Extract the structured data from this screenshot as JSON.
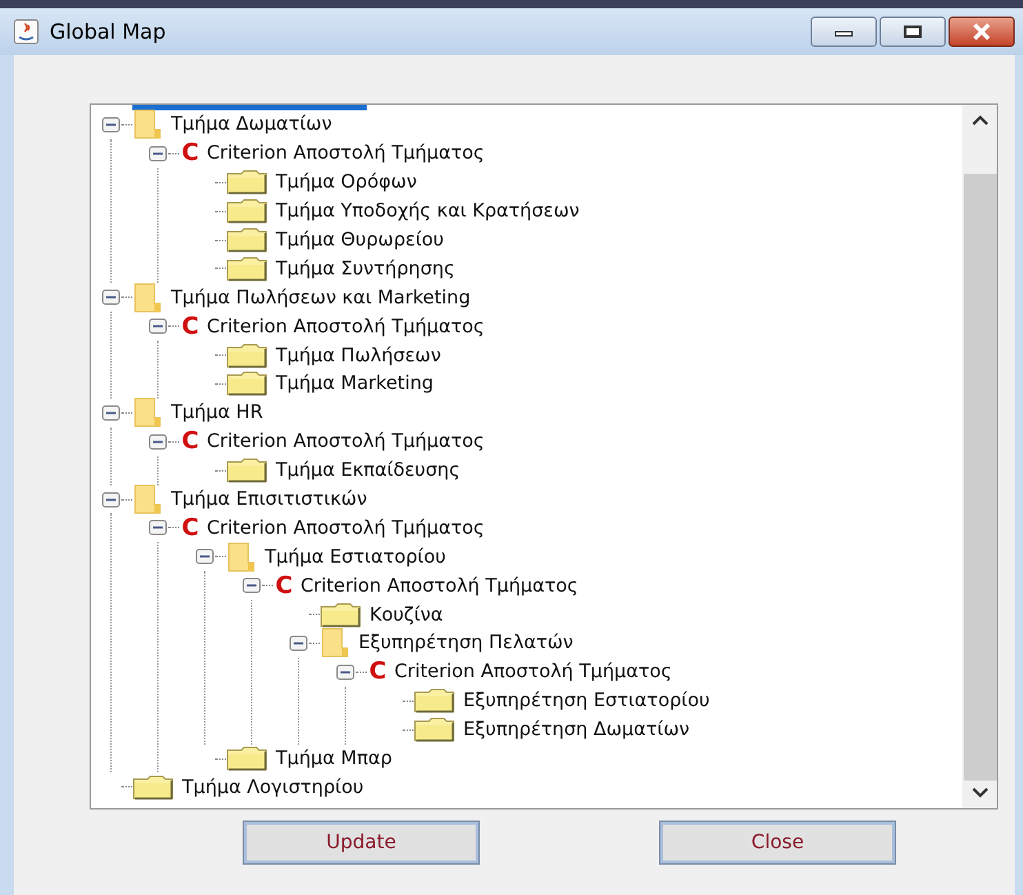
{
  "window": {
    "title": "Global Map"
  },
  "tree": {
    "nodes": [
      {
        "kind": "folder",
        "label": "Τμήμα Δωματίων",
        "expanded": true,
        "children": [
          {
            "kind": "criterion",
            "mark": "C",
            "label": "Criterion Αποστολή Τμήματος",
            "expanded": true,
            "children": [
              {
                "kind": "folder",
                "label": "Τμήμα Ορόφων"
              },
              {
                "kind": "folder",
                "label": "Τμήμα Υποδοχής και Κρατήσεων"
              },
              {
                "kind": "folder",
                "label": "Τμήμα Θυρωρείου"
              },
              {
                "kind": "folder",
                "label": "Τμήμα Συντήρησης"
              }
            ]
          }
        ]
      },
      {
        "kind": "folder",
        "label": "Τμήμα Πωλήσεων και Marketing",
        "expanded": true,
        "children": [
          {
            "kind": "criterion",
            "mark": "C",
            "label": "Criterion Αποστολή Τμήματος",
            "expanded": true,
            "children": [
              {
                "kind": "folder",
                "label": "Τμήμα Πωλήσεων"
              },
              {
                "kind": "folder",
                "label": "Τμήμα Marketing"
              }
            ]
          }
        ]
      },
      {
        "kind": "folder",
        "label": "Τμήμα HR",
        "expanded": true,
        "children": [
          {
            "kind": "criterion",
            "mark": "C",
            "label": "Criterion Αποστολή Τμήματος",
            "expanded": true,
            "children": [
              {
                "kind": "folder",
                "label": "Τμήμα Εκπαίδευσης"
              }
            ]
          }
        ]
      },
      {
        "kind": "folder",
        "label": "Τμήμα Επισιτιστικών",
        "expanded": true,
        "children": [
          {
            "kind": "criterion",
            "mark": "C",
            "label": "Criterion Αποστολή Τμήματος",
            "expanded": true,
            "children": [
              {
                "kind": "folder",
                "label": "Τμήμα Εστιατορίου",
                "expanded": true,
                "children": [
                  {
                    "kind": "criterion",
                    "mark": "C",
                    "label": "Criterion Αποστολή Τμήματος",
                    "expanded": true,
                    "children": [
                      {
                        "kind": "folder",
                        "label": "Κουζίνα"
                      },
                      {
                        "kind": "folder",
                        "label": "Εξυπηρέτηση Πελατών",
                        "expanded": true,
                        "children": [
                          {
                            "kind": "criterion",
                            "mark": "C",
                            "label": "Criterion Αποστολή Τμήματος",
                            "expanded": true,
                            "children": [
                              {
                                "kind": "folder",
                                "label": "Εξυπηρέτηση Εστιατορίου"
                              },
                              {
                                "kind": "folder",
                                "label": "Εξυπηρέτηση Δωματίων"
                              }
                            ]
                          }
                        ]
                      }
                    ]
                  }
                ]
              },
              {
                "kind": "folder",
                "label": "Τμήμα Μπαρ"
              }
            ]
          }
        ]
      },
      {
        "kind": "folder",
        "label": "Τμήμα Λογιστηρίου"
      }
    ]
  },
  "buttons": [
    "Update",
    "Close"
  ]
}
